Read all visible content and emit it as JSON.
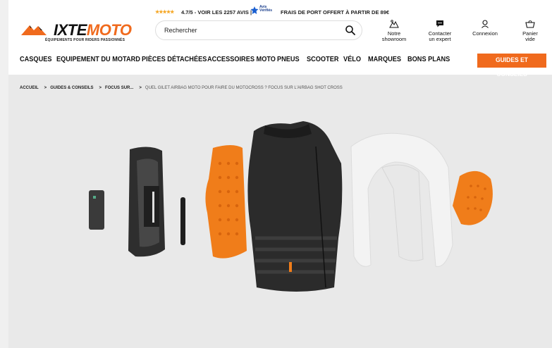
{
  "topbar": {
    "stars": "★★★★★",
    "rating_text": "4.7/5 - VOIR LES 2257 AVIS |",
    "badge_line1": "Avis",
    "badge_line2": "Vérifiés",
    "shipping_text": "FRAIS DE PORT OFFERT À PARTIR DE 89€"
  },
  "logo": {
    "word_a": "IXTE",
    "word_b": "MOTO",
    "tagline": "ÉQUIPEMENTS POUR RIDERS PASSIONNÉS",
    "accent": "#f06a1d"
  },
  "search": {
    "placeholder": "Rechercher"
  },
  "header_actions": [
    {
      "icon": "showroom-icon",
      "line1": "Notre",
      "line2": "showroom"
    },
    {
      "icon": "chat-icon",
      "line1": "Contacter",
      "line2": "un expert"
    },
    {
      "icon": "user-icon",
      "line1": "Connexion",
      "line2": ""
    },
    {
      "icon": "basket-icon",
      "line1": "Panier",
      "line2": "vide"
    }
  ],
  "nav": {
    "items": [
      "CASQUES",
      "EQUIPEMENT DU MOTARD",
      "PIÈCES DÉTACHÉES",
      "ACCESSOIRES MOTO",
      "PNEUS",
      "SCOOTER",
      "VÉLO",
      "MARQUES",
      "BONS PLANS"
    ],
    "highlight": "GUIDES ET CONSEILS"
  },
  "breadcrumb": {
    "items": [
      "ACCUEIL",
      "GUIDES & CONSEILS",
      "FOCUS SUR..."
    ],
    "separator": ">",
    "current": "QUEL GILET AIRBAG MOTO POUR FAIRE DU MOTOCROSS ? FOCUS SUR L'AIRBAG SHOT CROSS"
  }
}
